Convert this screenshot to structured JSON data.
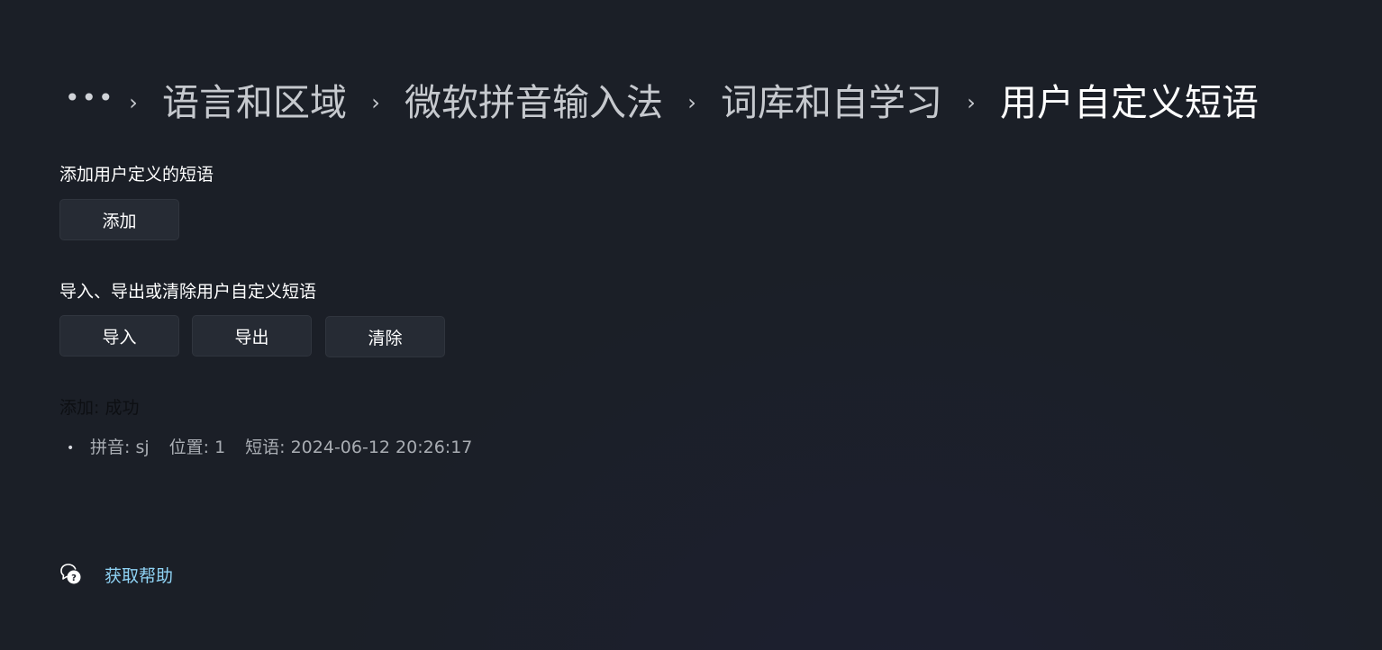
{
  "breadcrumb": {
    "more": "•••",
    "separator": "›",
    "items": [
      "语言和区域",
      "微软拼音输入法",
      "词库和自学习"
    ],
    "current": "用户自定义短语"
  },
  "add_section": {
    "label": "添加用户定义的短语",
    "add_button": "添加"
  },
  "io_section": {
    "label": "导入、导出或清除用户自定义短语",
    "import_button": "导入",
    "export_button": "导出",
    "clear_button": "清除"
  },
  "status": {
    "title": "添加: 成功",
    "bullet": "•",
    "pinyin": "拼音: sj",
    "position": "位置: 1",
    "phrase": "短语: 2024-06-12 20:26:17"
  },
  "help": {
    "icon": "help-chat-icon",
    "link": "获取帮助",
    "link_color": "#8fd3f5"
  }
}
